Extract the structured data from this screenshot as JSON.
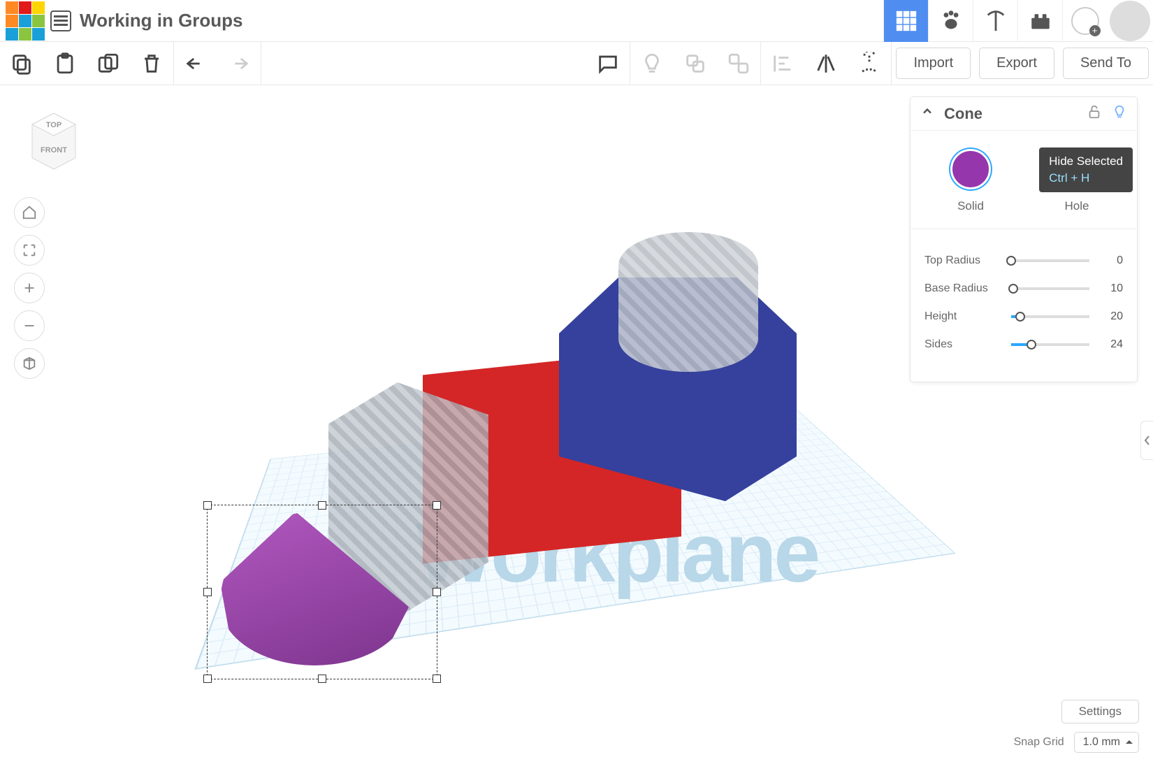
{
  "header": {
    "title": "Working in Groups"
  },
  "toolbar_actions": {
    "import": "Import",
    "export": "Export",
    "send_to": "Send To"
  },
  "viewcube": {
    "top": "TOP",
    "front": "FRONT"
  },
  "workplane_label": "Workplane",
  "inspector": {
    "name": "Cone",
    "solid_label": "Solid",
    "hole_label": "Hole",
    "tooltip_title": "Hide Selected",
    "tooltip_shortcut": "Ctrl + H",
    "params": [
      {
        "label": "Top Radius",
        "value": "0",
        "pct": 0
      },
      {
        "label": "Base Radius",
        "value": "10",
        "pct": 3
      },
      {
        "label": "Height",
        "value": "20",
        "pct": 12
      },
      {
        "label": "Sides",
        "value": "24",
        "pct": 26
      }
    ]
  },
  "footer": {
    "settings": "Settings",
    "snap_label": "Snap Grid",
    "snap_value": "1.0 mm"
  },
  "colors": {
    "accent": "#4f8ef0",
    "solid_swatch": "#9636ad"
  }
}
